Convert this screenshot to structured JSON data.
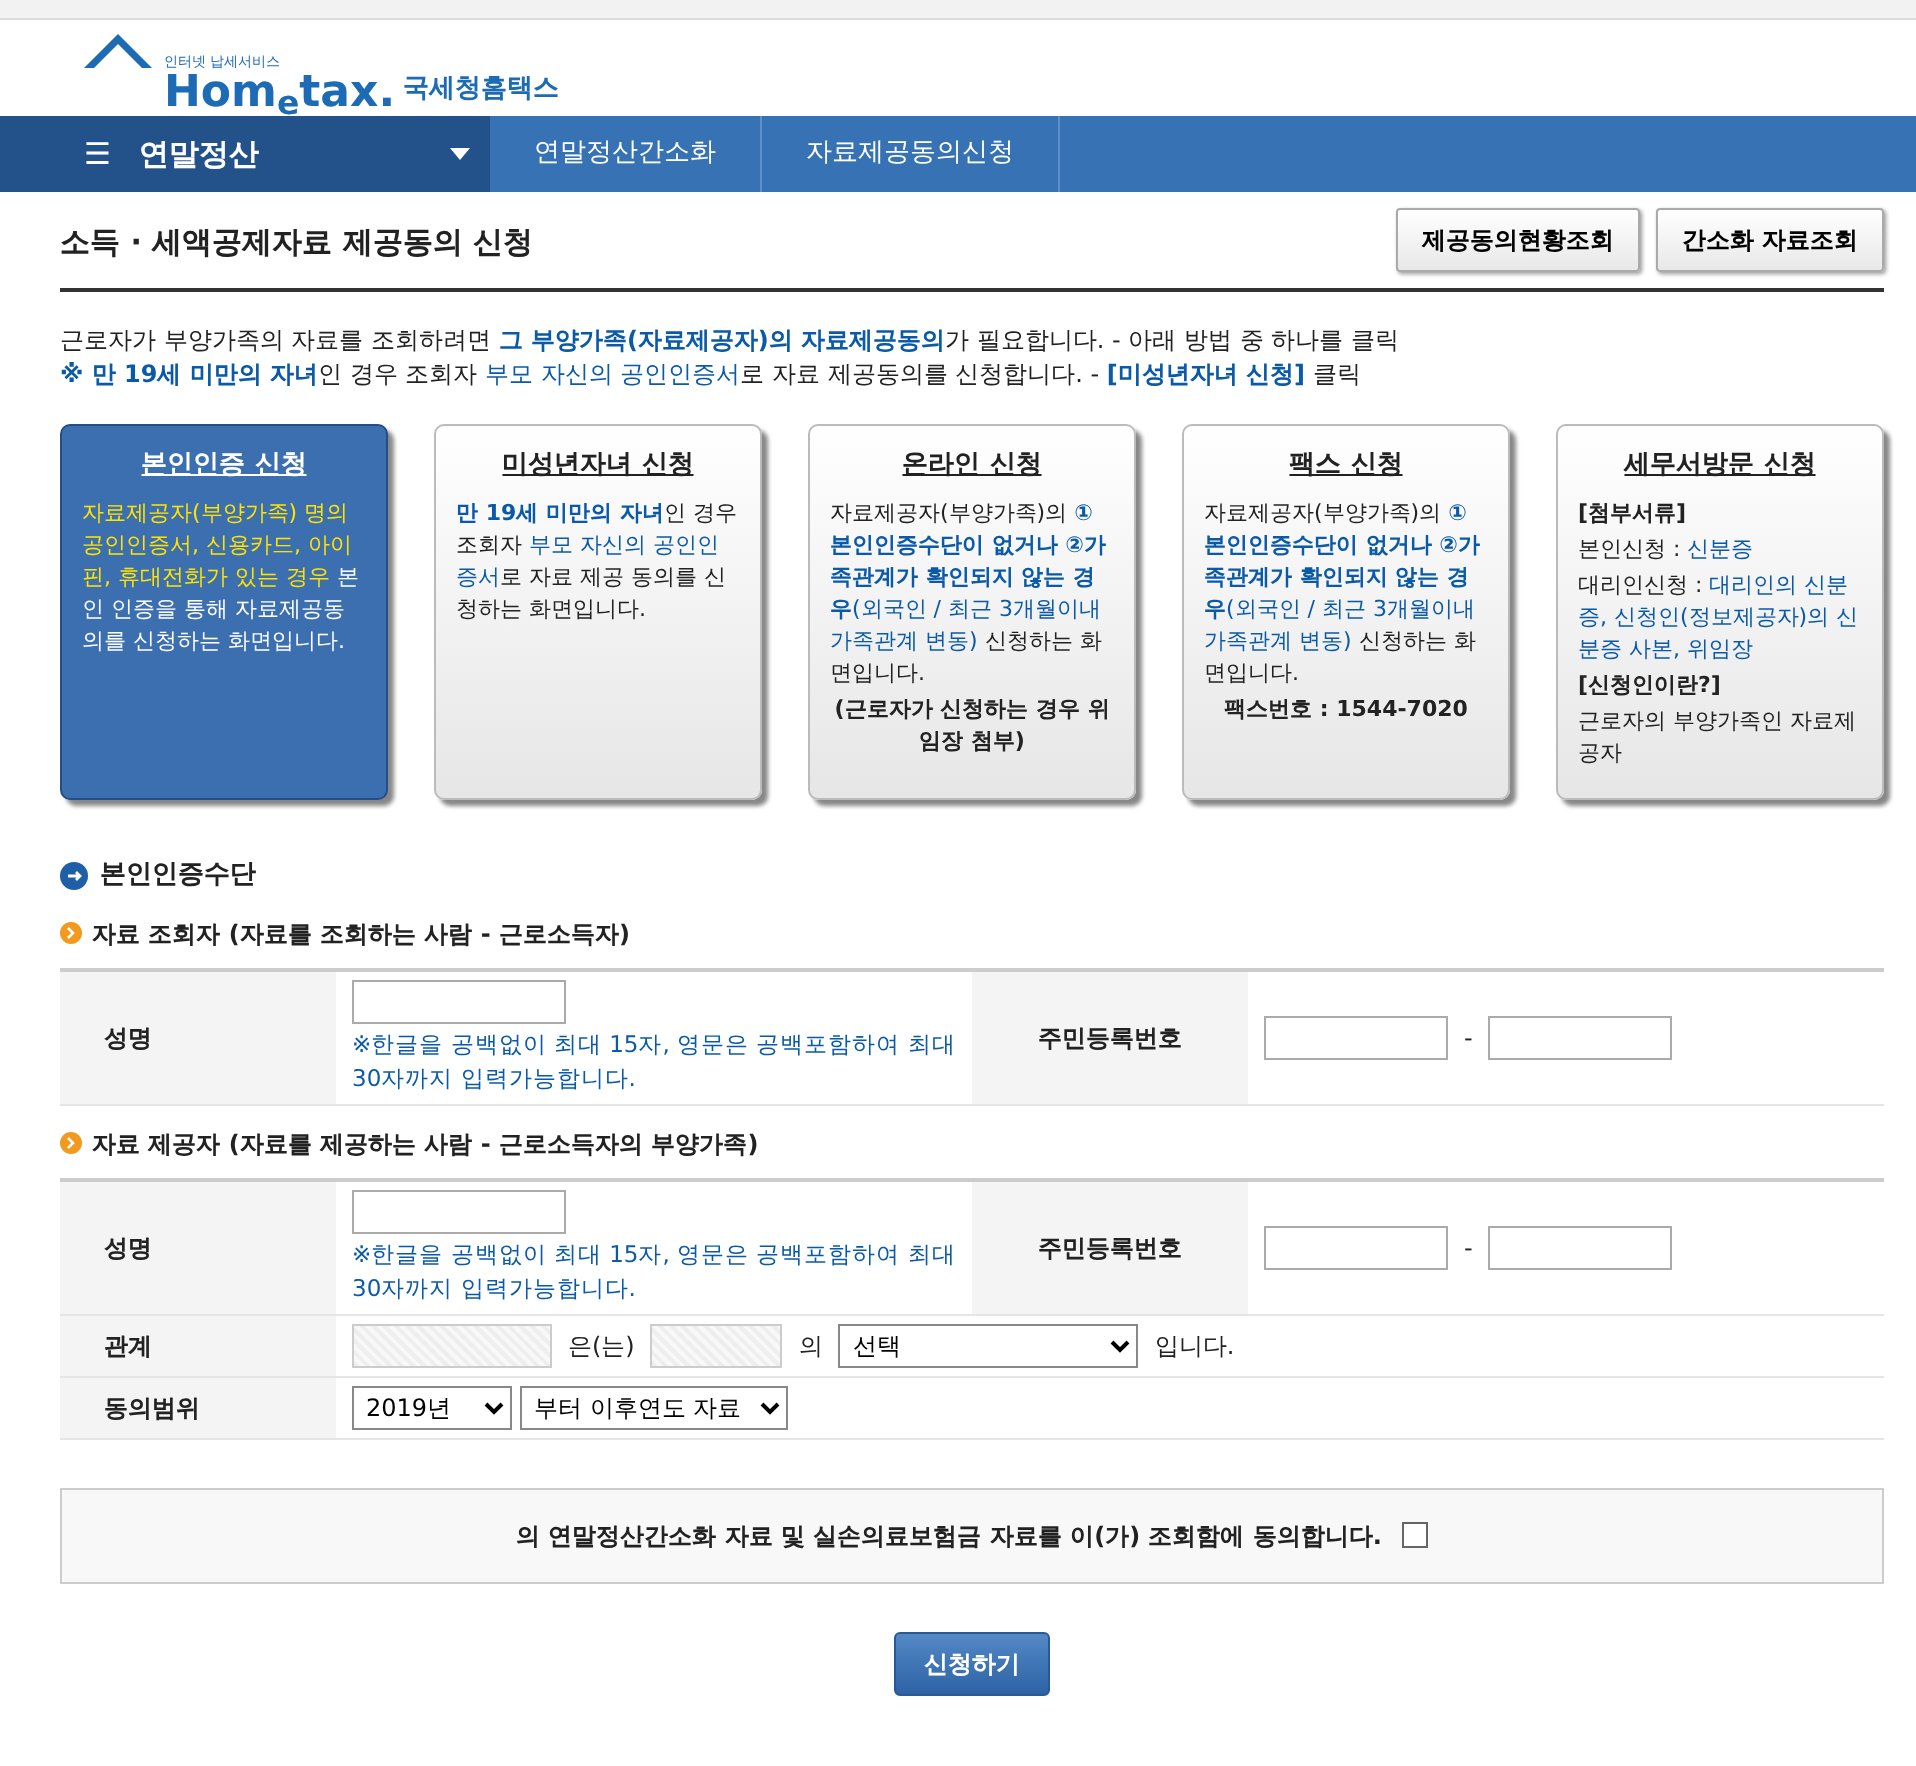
{
  "logo": {
    "tagline": "인터넷 납세서비스",
    "wordmark": "Hom$_{e}$tax.",
    "name": "국세청홈택스"
  },
  "nav": {
    "menu": "☰",
    "section": "연말정산",
    "crumbs": [
      "연말정산간소화",
      "자료제공동의신청"
    ]
  },
  "page_title": "소득 · 세액공제자료 제공동의 신청",
  "header_buttons": [
    "제공동의현황조회",
    "간소화 자료조회"
  ],
  "intro": [
    [
      {
        "text": "근로자가 부양가족의 자료를 조회하려면 ",
        "kind": "plain"
      },
      {
        "text": "그 부양가족(자료제공자)의 자료제공동의",
        "kind": "strong"
      },
      {
        "text": "가 필요합니다. - 아래 방법 중 하나를 클릭",
        "kind": "plain"
      }
    ],
    [
      {
        "text": "※ 만 19세 미만의 자녀",
        "kind": "strong"
      },
      {
        "text": "인 경우 조회자 ",
        "kind": "plain"
      },
      {
        "text": "부모 자신의 공인인증서",
        "kind": "accent"
      },
      {
        "text": "로 자료 제공동의를 신청합니다. - ",
        "kind": "plain"
      },
      {
        "text": "[미성년자녀 신청]",
        "kind": "strong"
      },
      {
        "text": " 클릭",
        "kind": "plain"
      }
    ]
  ],
  "cards": [
    {
      "title": "본인인증 신청",
      "selected": true,
      "paragraphs": [
        [
          {
            "text": "자료제공자(부양가족) 명의 공인인증서, 신용카드, 아이핀, 휴대전화가 있는 경우",
            "kind": "notice"
          },
          {
            "text": " 본인 인증을 통해 자료제공동의를 신청하는 화면입니다.",
            "kind": "plain"
          }
        ]
      ]
    },
    {
      "title": "미성년자녀 신청",
      "selected": false,
      "paragraphs": [
        [
          {
            "text": "만 19세 미만의 자녀",
            "kind": "strong"
          },
          {
            "text": "인 경우 조회자 ",
            "kind": "plain"
          },
          {
            "text": "부모 자신의 공인인증서",
            "kind": "accent"
          },
          {
            "text": "로 자료 제공 동의를 신청하는 화면입니다.",
            "kind": "plain"
          }
        ]
      ]
    },
    {
      "title": "온라인 신청",
      "selected": false,
      "paragraphs": [
        [
          {
            "text": "자료제공자(부양가족)의 ",
            "kind": "plain"
          },
          {
            "text": "①본인인증수단이 없거나 ②가족관계가 확인되지 않는 경우",
            "kind": "strong"
          },
          {
            "text": "(외국인 / 최근 3개월이내 가족관계 변동)",
            "kind": "accent"
          },
          {
            "text": " 신청하는 화면입니다.",
            "kind": "plain"
          }
        ],
        [
          {
            "text": "(근로자가 신청하는 경우 위임장 첨부)",
            "kind": "footnote"
          }
        ]
      ]
    },
    {
      "title": "팩스 신청",
      "selected": false,
      "paragraphs": [
        [
          {
            "text": "자료제공자(부양가족)의 ",
            "kind": "plain"
          },
          {
            "text": "①본인인증수단이 없거나 ②가족관계가 확인되지 않는 경우",
            "kind": "strong"
          },
          {
            "text": "(외국인 / 최근 3개월이내 가족관계 변동)",
            "kind": "accent"
          },
          {
            "text": " 신청하는 화면입니다.",
            "kind": "plain"
          }
        ],
        [
          {
            "text": "팩스번호 : 1544-7020",
            "kind": "footnote"
          }
        ]
      ]
    },
    {
      "title": "세무서방문 신청",
      "selected": false,
      "paragraphs": [
        [
          {
            "text": "[첨부서류]",
            "kind": "heading"
          }
        ],
        [
          {
            "text": "본인신청 : ",
            "kind": "plain"
          },
          {
            "text": "신분증",
            "kind": "accent"
          }
        ],
        [
          {
            "text": "대리인신청 : ",
            "kind": "plain"
          },
          {
            "text": "대리인의 신분증, 신청인(정보제공자)의 신분증 사본, 위임장",
            "kind": "accent"
          }
        ],
        [
          {
            "text": "[신청인이란?]",
            "kind": "heading"
          }
        ],
        [
          {
            "text": "근로자의 부양가족인 자료제공자",
            "kind": "plain"
          }
        ]
      ]
    }
  ],
  "section_title": "본인인증수단",
  "groups": [
    {
      "heading": "자료 조회자 (자료를 조회하는 사람 - 근로소득자)",
      "name_label": "성명",
      "note": "※한글을 공백없이 최대 15자, 영문은 공백포함하여 최대 30자까지 입력가능합니다.",
      "id_label": "주민등록번호",
      "id_separator": "-"
    },
    {
      "heading": "자료 제공자 (자료를 제공하는 사람 - 근로소득자의 부양가족)",
      "name_label": "성명",
      "note": "※한글을 공백없이 최대 15자, 영문은 공백포함하여 최대 30자까지 입력가능합니다.",
      "id_label": "주민등록번호",
      "id_separator": "-",
      "relation": {
        "label": "관계",
        "between": "은(는)",
        "of": "의",
        "select": "선택",
        "end": "입니다."
      },
      "scope": {
        "label": "동의범위",
        "year": "2019년",
        "range": "부터 이후연도 자료"
      }
    }
  ],
  "agreement": {
    "text": "의 연말정산간소화 자료 및 실손의료보험금 자료를 이(가) 조회함에 동의합니다.",
    "checked": false
  },
  "submit": "신청하기"
}
